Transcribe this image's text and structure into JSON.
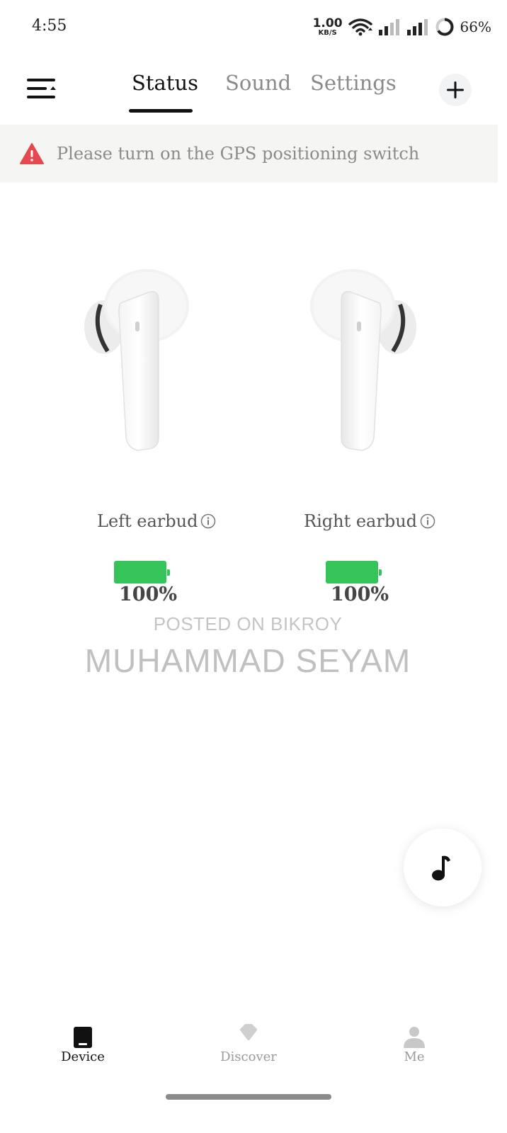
{
  "status_bar": {
    "time": "4:55",
    "net_speed_value": "1.00",
    "net_speed_unit": "KB/S",
    "battery": "66%"
  },
  "tabs": [
    {
      "label": "Status",
      "active": true
    },
    {
      "label": "Sound",
      "active": false
    },
    {
      "label": "Settings",
      "active": false
    }
  ],
  "banner": {
    "message": "Please turn on the GPS positioning switch",
    "warning_color": "#e5484d"
  },
  "earbuds": {
    "left": {
      "label": "Left earbud",
      "battery_text": "100%",
      "battery_level": 1.0
    },
    "right": {
      "label": "Right earbud",
      "battery_text": "100%",
      "battery_level": 1.0
    }
  },
  "watermark": {
    "line1": "POSTED ON BIKROY",
    "line2": "MUHAMMAD SEYAM"
  },
  "bottom_nav": [
    {
      "label": "Device",
      "icon": "device-icon",
      "active": true
    },
    {
      "label": "Discover",
      "icon": "diamond-icon",
      "active": false
    },
    {
      "label": "Me",
      "icon": "person-icon",
      "active": false
    }
  ],
  "colors": {
    "battery_green": "#34c459",
    "accent": "#111111",
    "banner_bg": "#f5f5f3"
  }
}
